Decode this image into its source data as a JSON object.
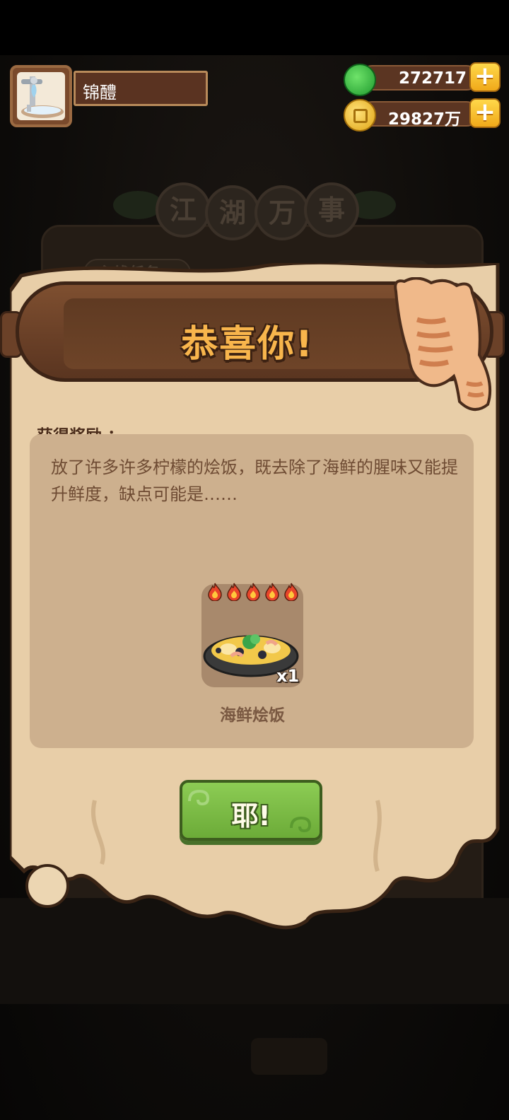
{
  "player": {
    "name": "锦醴",
    "avatar_icon": "faucet-basin-icon"
  },
  "resources": [
    {
      "name": "jade",
      "icon": "green-jade-icon",
      "value": "272717"
    },
    {
      "name": "coins",
      "icon": "gold-coin-icon",
      "value": "29827万"
    }
  ],
  "background": {
    "title_chars": [
      "江",
      "湖",
      "万",
      "事"
    ],
    "tab_label": "主线任务"
  },
  "modal": {
    "title": "恭喜你!",
    "reward_label": "获得奖励 ：",
    "description": "放了许多许多柠檬的烩饭，既去除了海鲜的腥味又能提升鲜度，缺点可能是……",
    "item": {
      "name": "海鲜烩饭",
      "quantity": "x1",
      "flame_rating": 5,
      "icon": "seafood-paella-icon"
    },
    "confirm_label": "耶!"
  },
  "colors": {
    "title": "#f8b54c",
    "button_green": "#7cbd46",
    "parchment": "#e8cea8",
    "panel": "#cdb08e"
  }
}
